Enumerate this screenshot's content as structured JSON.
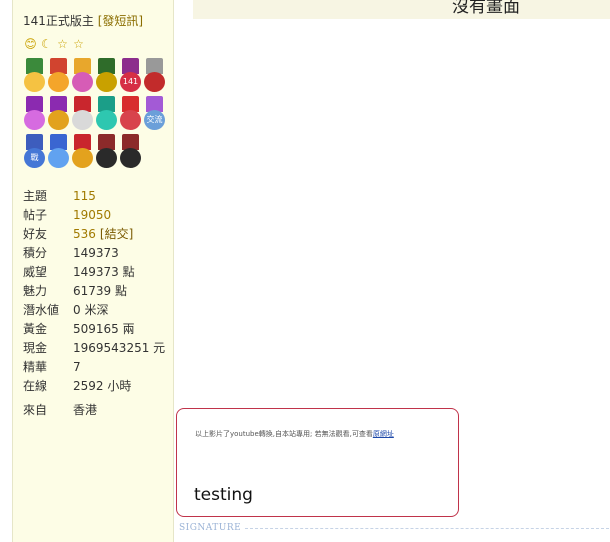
{
  "post_top": {
    "text": "沒有畫面",
    "quote_mark": "”"
  },
  "user": {
    "rank_title": "141正式版主",
    "send_pm_link": "[發短訊]",
    "stars": [
      "😊",
      "☾",
      "☆",
      "☆"
    ],
    "medal_colors": [
      [
        "#3b8a3b",
        "#f5c242"
      ],
      [
        "#d1442f",
        "#f4a52a"
      ],
      [
        "#e8a72c",
        "#d65cb6"
      ],
      [
        "#2f6c2a",
        "#c9a100"
      ],
      [
        "#8c2d8c",
        "#d62f45"
      ],
      [
        "#999999",
        "#c22b2b"
      ],
      [
        "#8b2ab0",
        "#d66be0"
      ],
      [
        "#8b2ab0",
        "#e2a21e"
      ],
      [
        "#c9262d",
        "#d9d9d9"
      ],
      [
        "#1b9e88",
        "#2ec7b0"
      ],
      [
        "#d82d2d",
        "#d8434c"
      ],
      [
        "#a35ad6",
        "#6b9fd9"
      ],
      [
        "#3d5dbd",
        "#4577d6"
      ],
      [
        "#3a66d1",
        "#61a2f0"
      ],
      [
        "#c9262d",
        "#e3a21e"
      ],
      [
        "#8c2a2a",
        "#2a2a2a"
      ],
      [
        "#8c2a2a",
        "#2a2a2a"
      ]
    ],
    "medal_badges": [
      "",
      "",
      "",
      "",
      "141",
      "",
      "",
      "",
      "",
      "",
      "",
      "交流",
      "戰",
      "",
      "",
      "",
      ""
    ],
    "stats": [
      {
        "label": "主題",
        "value": "115",
        "gold": true
      },
      {
        "label": "帖子",
        "value": "19050",
        "gold": true
      },
      {
        "label": "好友",
        "value": "536",
        "link": "[結交]",
        "gold": true
      },
      {
        "label": "積分",
        "value": "149373"
      },
      {
        "label": "威望",
        "value": "149373 點"
      },
      {
        "label": "魅力",
        "value": "61739 點"
      },
      {
        "label": "潛水値",
        "value": "0 米深"
      },
      {
        "label": "黃金",
        "value": "509165 兩"
      },
      {
        "label": "現金",
        "value": "1969543251 元"
      },
      {
        "label": "精華",
        "value": "7"
      },
      {
        "label": "在線",
        "value": "2592 小時"
      }
    ],
    "from_label": "來自",
    "from_value": "香港"
  },
  "signature": {
    "small_text": "以上影片了youtube轉換,自本站專用; 若無法觀看,可查看",
    "small_link": "原網址",
    "main_text": "testing",
    "section_label": "SIGNATURE"
  }
}
